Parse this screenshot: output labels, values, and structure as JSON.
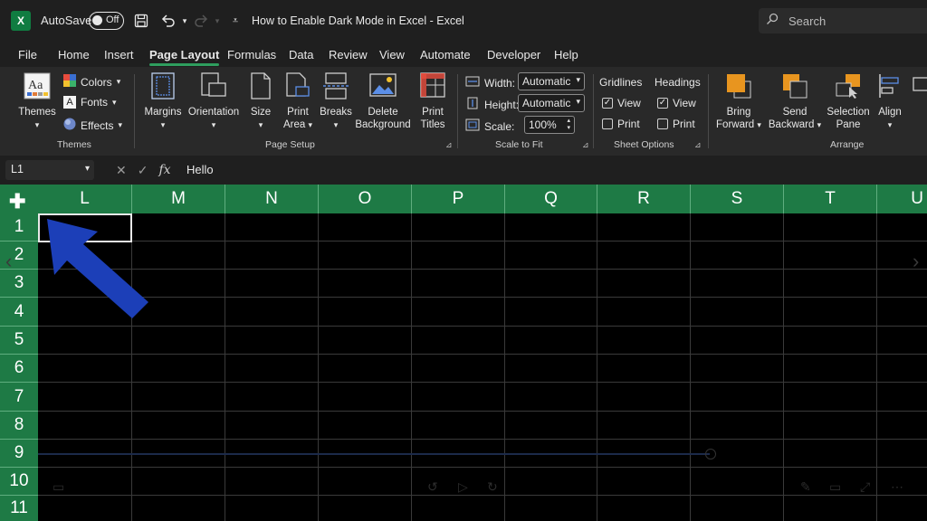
{
  "titlebar": {
    "app_icon": "X",
    "autosave_label": "AutoSave",
    "autosave_state": "Off",
    "document_title": "How to Enable Dark Mode in Excel  -  Excel",
    "search_placeholder": "Search",
    "icons": [
      "save-icon",
      "undo-icon",
      "redo-icon",
      "customize-qat-icon",
      "search-icon"
    ]
  },
  "tabs": [
    {
      "label": "File"
    },
    {
      "label": "Home"
    },
    {
      "label": "Insert"
    },
    {
      "label": "Page Layout",
      "active": true
    },
    {
      "label": "Formulas"
    },
    {
      "label": "Data"
    },
    {
      "label": "Review"
    },
    {
      "label": "View"
    },
    {
      "label": "Automate"
    },
    {
      "label": "Developer"
    },
    {
      "label": "Help"
    }
  ],
  "ribbon": {
    "themes": {
      "themes_label": "Themes",
      "colors_label": "Colors",
      "fonts_label": "Fonts",
      "effects_label": "Effects",
      "group_label": "Themes"
    },
    "page_setup": {
      "margins": "Margins",
      "orientation": "Orientation",
      "size": "Size",
      "print_area_1": "Print",
      "print_area_2": "Area",
      "breaks": "Breaks",
      "background_1": "Delete",
      "background_2": "Background",
      "print_titles_1": "Print",
      "print_titles_2": "Titles",
      "group_label": "Page Setup"
    },
    "scale_to_fit": {
      "width_label": "Width:",
      "width_value": "Automatic",
      "height_label": "Height:",
      "height_value": "Automatic",
      "scale_label": "Scale:",
      "scale_value": "100%",
      "group_label": "Scale to Fit"
    },
    "sheet_options": {
      "gridlines_label": "Gridlines",
      "headings_label": "Headings",
      "view_label": "View",
      "print_label": "Print",
      "gridlines_view_checked": true,
      "gridlines_print_checked": false,
      "headings_view_checked": true,
      "headings_print_checked": false,
      "group_label": "Sheet Options"
    },
    "arrange": {
      "bring_forward_1": "Bring",
      "bring_forward_2": "Forward",
      "send_backward_1": "Send",
      "send_backward_2": "Backward",
      "selection_pane_1": "Selection",
      "selection_pane_2": "Pane",
      "align": "Align",
      "group_label": "Arrange"
    }
  },
  "formula_bar": {
    "name_box": "L1",
    "fx": "fx",
    "content": "Hello"
  },
  "grid": {
    "columns": [
      "L",
      "M",
      "N",
      "O",
      "P",
      "Q",
      "R",
      "S",
      "T",
      "U"
    ],
    "rows": [
      "1",
      "2",
      "3",
      "4",
      "5",
      "6",
      "7",
      "8",
      "9",
      "10",
      "11"
    ],
    "active_cell": "L1"
  },
  "colors": {
    "header_green": "#1e7a45",
    "ribbon_bg": "#292929",
    "title_bg": "#1f1f1f",
    "arrow_blue": "#1c3fb8",
    "accent_orange": "#e8951f"
  }
}
